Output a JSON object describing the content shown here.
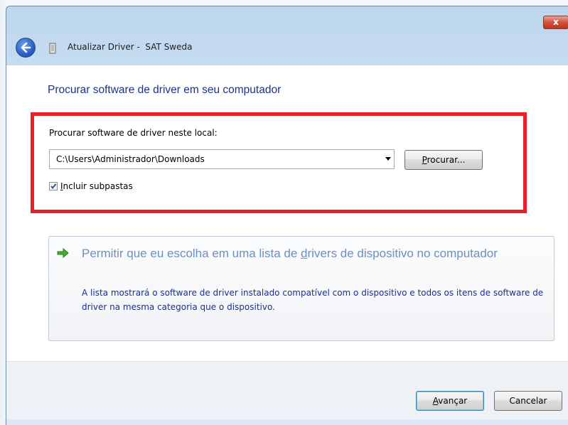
{
  "window": {
    "title": "Atualizar Driver -  SAT Sweda",
    "close_label": "x"
  },
  "page": {
    "heading": "Procurar software de driver em seu computador"
  },
  "search": {
    "label": "Procurar software de driver neste local:",
    "path_value": "C:\\Users\\Administrador\\Downloads",
    "browse_accel": "P",
    "browse_rest": "rocurar...",
    "include_subfolders_accel": "I",
    "include_subfolders_rest": "ncluir subpastas",
    "include_subfolders_checked": true
  },
  "option": {
    "title_part1": "Permitir que eu escolha em uma lista de ",
    "title_accel": "d",
    "title_part2": "rivers de dispositivo no computador",
    "description": "A lista mostrará o software de driver instalado compatível com o dispositivo e todos os itens de software de driver na mesma categoria que o dispositivo.",
    "icon": "green-arrow-icon"
  },
  "footer": {
    "next_accel": "A",
    "next_rest": "vançar",
    "cancel_label": "Cancelar"
  },
  "colors": {
    "highlight_border": "#e8202a",
    "heading": "#1e3287",
    "option_title": "#6d8fc2",
    "option_description": "#1a2f97"
  }
}
